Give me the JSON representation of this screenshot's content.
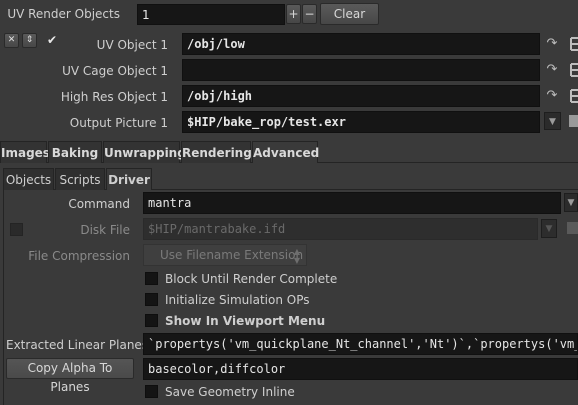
{
  "uv_render": {
    "label": "UV Render Objects",
    "count": "1",
    "plus": "+",
    "minus": "−",
    "clear": "Clear"
  },
  "uv_objects": [
    {
      "label": "UV Object 1",
      "value": "/obj/low"
    },
    {
      "label": "UV Cage Object 1",
      "value": ""
    },
    {
      "label": "High Res Object 1",
      "value": "/obj/high"
    },
    {
      "label": "Output Picture 1",
      "value": "$HIP/bake_rop/test.exr"
    }
  ],
  "entry_buttons": {
    "remove": "✕",
    "move": "⇕",
    "check": "✔"
  },
  "tabs": [
    "Images",
    "Baking",
    "Unwrapping",
    "Rendering",
    "Advanced"
  ],
  "subtabs": [
    "Objects",
    "Scripts",
    "Driver"
  ],
  "driver": {
    "command_label": "Command",
    "command_value": "mantra",
    "disk_file_label": "Disk File",
    "disk_file_value": "$HIP/mantrabake.ifd",
    "file_compression_label": "File Compression",
    "file_compression_value": "Use Filename Extension",
    "block_until_render": "Block Until Render Complete",
    "init_simulation": "Initialize Simulation OPs",
    "show_in_viewport": "Show In Viewport Menu",
    "extracted_planes_label": "Extracted Linear Planes",
    "extracted_planes_value": "`propertys('vm_quickplane_Nt_channel','Nt')`,`propertys('vm_q",
    "copy_alpha_label": "Copy Alpha To Planes",
    "copy_alpha_value": "basecolor,diffcolor",
    "save_geometry": "Save Geometry Inline"
  },
  "icons": {
    "chooser": "arrow-chooser-icon",
    "node_tree": "node-tree-icon",
    "dropdown": "dropdown-arrow-icon"
  }
}
